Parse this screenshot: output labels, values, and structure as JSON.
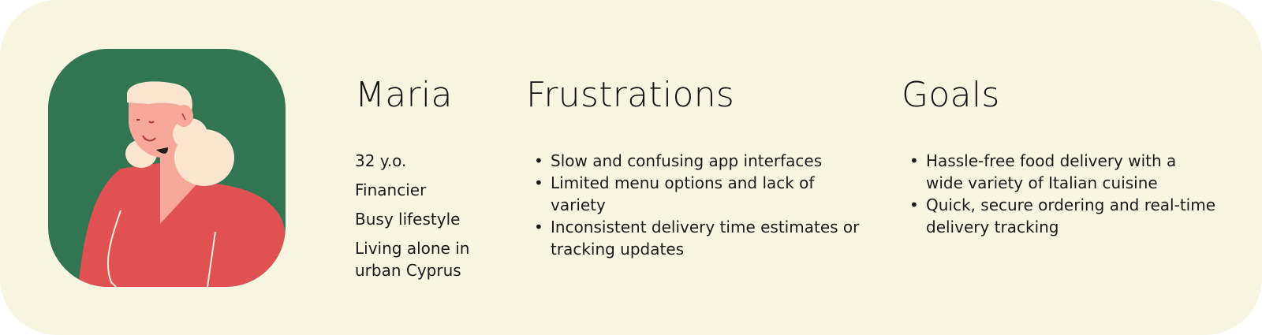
{
  "persona": {
    "name": "Maria",
    "facts": [
      "32 y.o.",
      "Financier",
      "Busy lifestyle",
      "Living alone in urban Cyprus"
    ]
  },
  "frustrations": {
    "title": "Frustrations",
    "items": [
      "Slow and confusing app interfaces",
      "Limited menu options and lack of variety",
      "Inconsistent delivery time estimates or tracking updates"
    ]
  },
  "goals": {
    "title": "Goals",
    "items": [
      "Hassle-free food delivery with a wide variety of Italian cuisine",
      "Quick, secure ordering and real-time delivery tracking"
    ]
  },
  "bullet_glyph": "•",
  "colors": {
    "card_background": "#f8f6e3",
    "avatar_background": "#327552",
    "shirt": "#e05252",
    "skin": "#f7a898",
    "hair": "#fae6d0"
  },
  "icons": {
    "avatar": "woman-portrait-illustration"
  }
}
